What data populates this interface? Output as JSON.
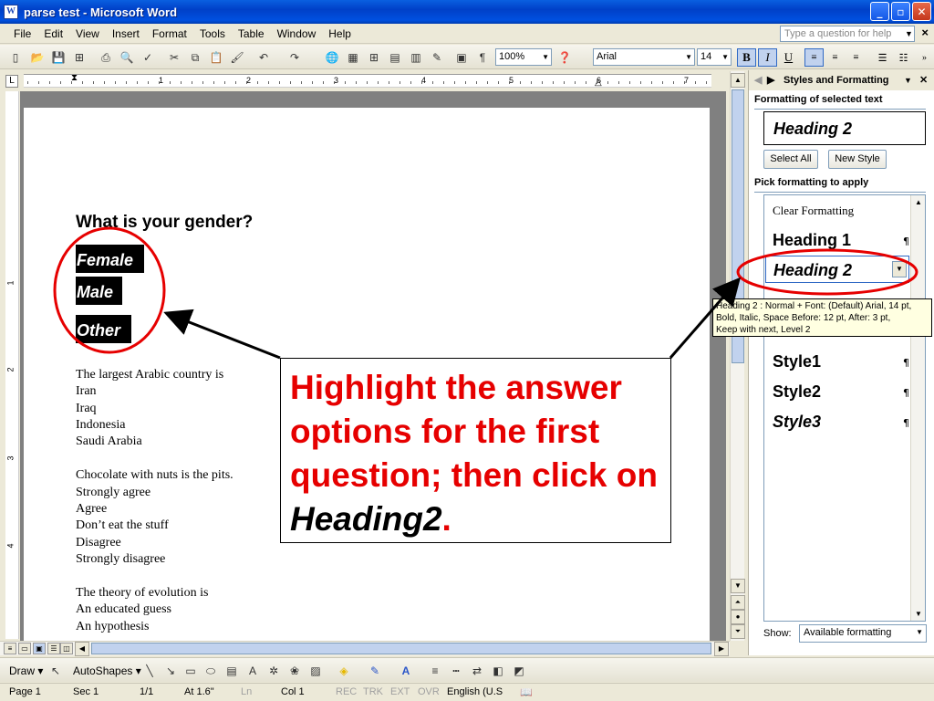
{
  "window": {
    "title": "parse test - Microsoft Word",
    "icon_letter": "W",
    "controls": {
      "minimize": "_",
      "maximize": "▫",
      "close": "✕"
    }
  },
  "menu": {
    "items": [
      "File",
      "Edit",
      "View",
      "Insert",
      "Format",
      "Tools",
      "Table",
      "Window",
      "Help"
    ],
    "help_placeholder": "Type a question for help",
    "close_doc": "×"
  },
  "toolbar": {
    "zoom": "100%",
    "font": "Arial",
    "size": "14",
    "bold": "B",
    "italic": "I",
    "underline": "U",
    "pilcrow": "¶"
  },
  "ruler": {
    "labels": [
      "1",
      "2",
      "3",
      "4",
      "5",
      "6",
      "7"
    ],
    "vlabels": [
      "1",
      "2",
      "3",
      "4"
    ],
    "tab_stop": "L"
  },
  "document": {
    "question1": "What is your gender?",
    "options1": [
      "Female",
      "Male",
      "Other"
    ],
    "block2": [
      "The largest Arabic country is",
      "Iran",
      "Iraq",
      "Indonesia",
      "Saudi Arabia"
    ],
    "block3": [
      "Chocolate with nuts is the pits.",
      "Strongly agree",
      "Agree",
      "Don’t eat the stuff",
      "Disagree",
      "Strongly disagree"
    ],
    "block4": [
      "The theory of evolution is",
      "An educated guess",
      "An hypothesis"
    ]
  },
  "task_pane": {
    "title": "Styles and Formatting",
    "selected_label": "Formatting of selected text",
    "current_style": "Heading 2",
    "select_all": "Select All",
    "new_style": "New Style",
    "pick_label": "Pick formatting to apply",
    "styles": [
      "Clear Formatting",
      "Heading 1",
      "Heading 2",
      "Style1",
      "Style2",
      "Style3"
    ],
    "pilcrow": "¶",
    "show_label": "Show:",
    "show_value": "Available formatting"
  },
  "tooltip": {
    "lines": [
      "Heading 2 : Normal + Font: (Default) Arial, 14 pt,",
      "Bold, Italic, Space Before:  12 pt, After:  3 pt,",
      "Keep with next, Level 2"
    ]
  },
  "callout": {
    "text_before": "Highlight the answer options for the first question; then click on ",
    "emphasis": "Heading2",
    "text_after": "."
  },
  "drawing_toolbar": {
    "draw": "Draw",
    "autoshapes": "AutoShapes"
  },
  "status": {
    "page": "Page 1",
    "sec": "Sec 1",
    "pages": "1/1",
    "at": "At 1.6\"",
    "ln": "Ln",
    "col": "Col 1",
    "rec": "REC",
    "trk": "TRK",
    "ext": "EXT",
    "ovr": "OVR",
    "language": "English (U.S"
  },
  "colors": {
    "annotation_red": "#e60000",
    "titlebar_blue": "#0050e0"
  }
}
